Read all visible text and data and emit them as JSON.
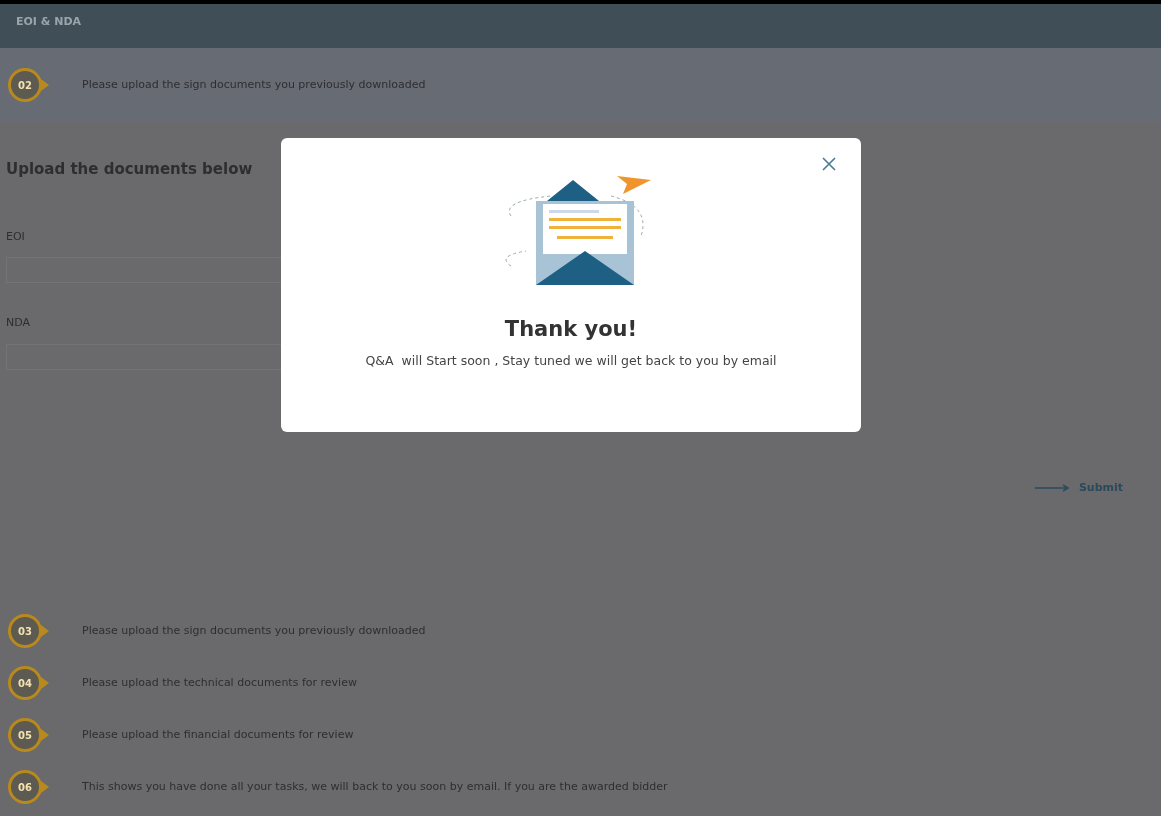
{
  "header": {
    "title": "EOI & NDA"
  },
  "active_step": {
    "number": "02",
    "text": "Please upload the sign documents you previously downloaded"
  },
  "upload": {
    "heading": "Upload the documents below",
    "fields": [
      {
        "label": "EOI"
      },
      {
        "label": "NDA"
      }
    ],
    "submit": "Submit"
  },
  "steps": [
    {
      "number": "03",
      "text": "Please upload the sign documents you previously downloaded"
    },
    {
      "number": "04",
      "text": "Please upload the technical documents for review"
    },
    {
      "number": "05",
      "text": "Please upload the financial documents for review"
    },
    {
      "number": "06",
      "text": "This shows you have done all your tasks, we will back to you soon by email. If you are the awarded bidder"
    }
  ],
  "modal": {
    "title": "Thank you!",
    "message": "Q&A  will Start soon , Stay tuned we will get back to you by email"
  }
}
